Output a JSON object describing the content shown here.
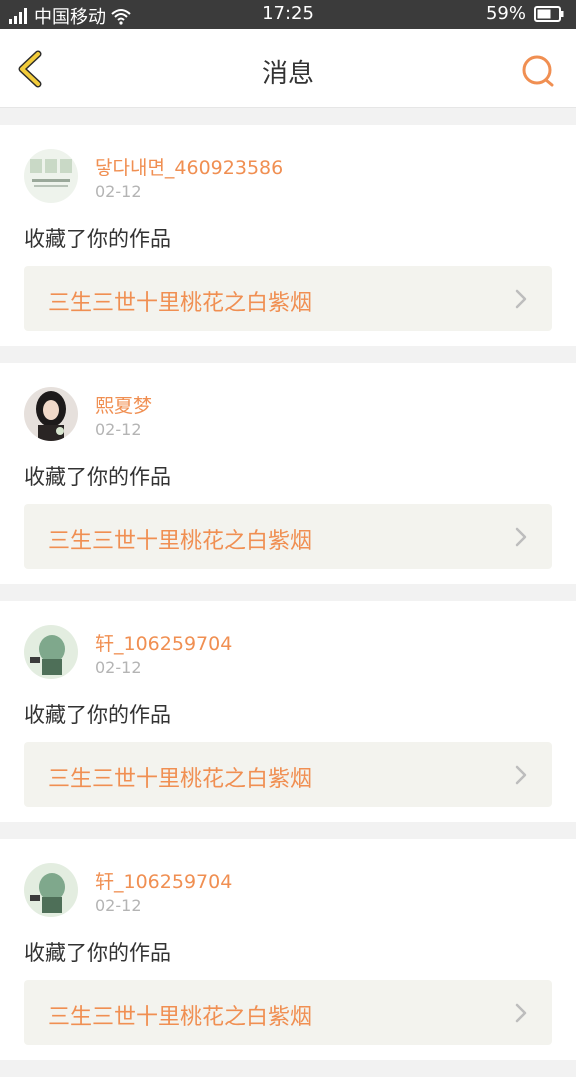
{
  "status_bar": {
    "carrier": "中国移动",
    "time": "17:25",
    "battery": "59%"
  },
  "nav": {
    "title": "消息",
    "back_icon": "chevron-left-icon",
    "search_icon": "search-icon"
  },
  "colors": {
    "accent": "#f08f52",
    "back_yellow": "#f2cc3b"
  },
  "messages": [
    {
      "username": "닿다내면_460923586",
      "date": "02-12",
      "text": "收藏了你的作品",
      "work_title": "三生三世十里桃花之白紫烟"
    },
    {
      "username": "熙夏梦",
      "date": "02-12",
      "text": "收藏了你的作品",
      "work_title": "三生三世十里桃花之白紫烟"
    },
    {
      "username": "轩_106259704",
      "date": "02-12",
      "text": "收藏了你的作品",
      "work_title": "三生三世十里桃花之白紫烟"
    },
    {
      "username": "轩_106259704",
      "date": "02-12",
      "text": "收藏了你的作品",
      "work_title": "三生三世十里桃花之白紫烟"
    }
  ]
}
